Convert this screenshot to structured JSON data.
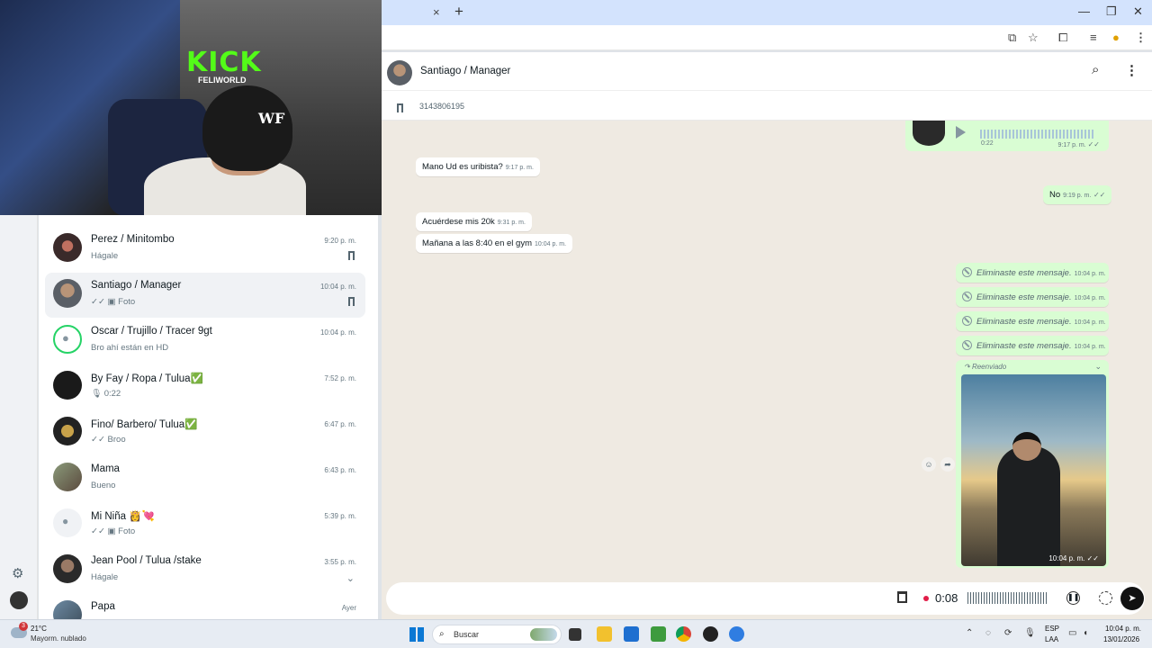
{
  "browser": {
    "tab_close_icon": "×",
    "new_tab_icon": "+",
    "window_controls": [
      "—",
      "❐",
      "✕"
    ]
  },
  "chats": [
    {
      "name": "Perez / Minitombo",
      "preview": "Hágale",
      "time": "9:20 p. m.",
      "pinned": true
    },
    {
      "name": "Santiago  / Manager",
      "preview": "✓✓ ▣ Foto",
      "time": "10:04 p. m.",
      "pinned": true,
      "active": true
    },
    {
      "name": "Oscar / Trujillo / Tracer 9gt",
      "preview": "Bro ahí están en HD",
      "time": "10:04 p. m."
    },
    {
      "name": "By Fay / Ropa / Tulua✅",
      "preview": "🎙 0:22",
      "time": "7:52 p. m."
    },
    {
      "name": "Fino/ Barbero/ Tulua✅",
      "preview": "✓✓ Broo",
      "time": "6:47 p. m."
    },
    {
      "name": "Mama",
      "preview": "Bueno",
      "time": "6:43 p. m."
    },
    {
      "name": "Mi Niña 👸💘",
      "preview": "✓✓ ▣ Foto",
      "time": "5:39 p. m."
    },
    {
      "name": "Jean Pool / Tulua /stake",
      "preview": "Hágale",
      "time": "3:55 p. m."
    },
    {
      "name": "Papa",
      "preview": "",
      "time": "Ayer"
    }
  ],
  "conversation": {
    "contact_name": "Santiago  / Manager",
    "pinned_text": "3143806195",
    "voice_note": {
      "duration": "0:22",
      "time": "9:17 p. m."
    },
    "messages": [
      {
        "text": "Mano Ud es uribista?",
        "time": "9:17 p. m."
      },
      {
        "text": "No",
        "time": "9:19 p. m."
      },
      {
        "text": "Acuérdese mis 20k",
        "time": "9:31 p. m."
      },
      {
        "text": "Mañana a las 8:40 en el gym",
        "time": "10:04 p. m."
      }
    ],
    "deleted": [
      {
        "text": "Eliminaste este mensaje.",
        "time": "10:04 p. m."
      },
      {
        "text": "Eliminaste este mensaje.",
        "time": "10:04 p. m."
      },
      {
        "text": "Eliminaste este mensaje.",
        "time": "10:04 p. m."
      },
      {
        "text": "Eliminaste este mensaje.",
        "time": "10:04 p. m."
      }
    ],
    "media": {
      "forwarded_label": "Reenviado",
      "time": "10:04 p. m."
    }
  },
  "composer": {
    "record_time": "0:08"
  },
  "webcam": {
    "brand": "KICK",
    "brand_sub": "FELIWORLD",
    "cap_logo": "WF"
  },
  "taskbar": {
    "weather_badge": "3",
    "temp": "21°C",
    "weather": "Mayorm. nublado",
    "search_placeholder": "Buscar",
    "lang1": "ESP",
    "lang2": "LAA",
    "time": "10:04 p. m.",
    "date": "13/01/2026"
  }
}
